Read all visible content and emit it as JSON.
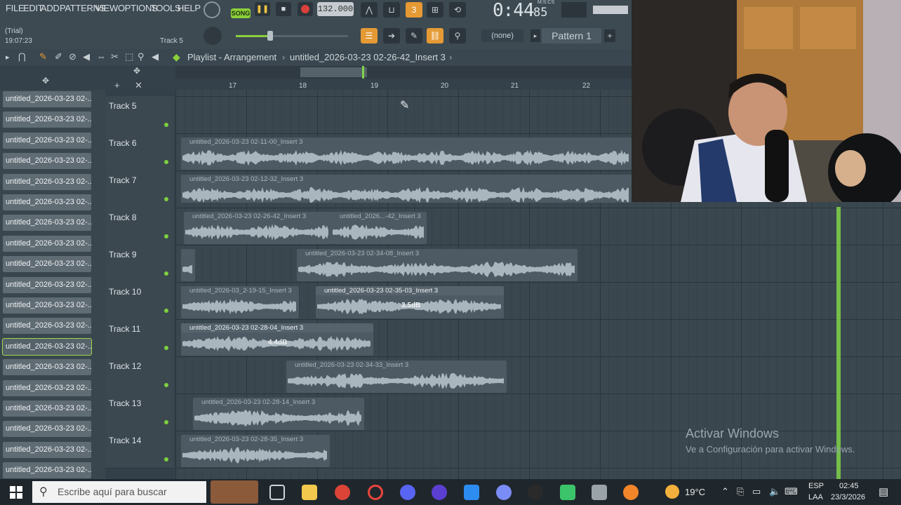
{
  "menu": [
    "FILE",
    "EDIT",
    "ADD",
    "PATTERNS",
    "VIEW",
    "OPTIONS",
    "TOOLS",
    "HELP"
  ],
  "trial": {
    "label": "(Trial)",
    "time": "19:07:23",
    "track": "Track 5"
  },
  "transport": {
    "song_label": "SONG",
    "bpm": "132.000",
    "time_main": "0:44",
    "time_sub": "85",
    "time_unit": "M:S:CS"
  },
  "selectors": {
    "none_label": "(none)",
    "pattern_label": "Pattern 1"
  },
  "playlist": {
    "title": "Playlist - Arrangement",
    "breadcrumb": "untitled_2026-03-23 02-26-42_Insert 3",
    "arrow": "›"
  },
  "ruler": [
    "17",
    "18",
    "19",
    "20",
    "21",
    "22"
  ],
  "browser_items": [
    "untitled_2026-03-23 02-...",
    "untitled_2026-03-23 02-...",
    "untitled_2026-03-23 02-...",
    "untitled_2026-03-23 02-...",
    "untitled_2026-03-23 02-...",
    "untitled_2026-03-23 02-...",
    "untitled_2026-03-23 02-...",
    "untitled_2026-03-23 02-...",
    "untitled_2026-03-23 02-...",
    "untitled_2026-03-23 02-...",
    "untitled_2026-03-23 02-...",
    "untitled_2026-03-23 02-...",
    "untitled_2026-03-23 02-...",
    "untitled_2026-03-23 02-...",
    "untitled_2026-03-23 02-...",
    "untitled_2026-03-23 02-...",
    "untitled_2026-03-23 02-...",
    "untitled_2026-03-23 02-...",
    "untitled_2026-03-23 02-..."
  ],
  "tracks": [
    "Track 5",
    "Track 6",
    "Track 7",
    "Track 8",
    "Track 9",
    "Track 10",
    "Track 11",
    "Track 12",
    "Track 13",
    "Track 14"
  ],
  "clips": {
    "c6": "untitled_2026-03-23 02-11-00_Insert 3",
    "c7": "untitled_2026-03-23 02-12-32_Insert 3",
    "c8a": "untitled_2026-03-23 02-26-42_Insert 3",
    "c8b": "untitled_2026...-42_Insert 3",
    "c9": "untitled_2026-03-23 02-34-08_Insert 3",
    "c10a": "untitled_2026-03_2-19-15_Insert 3",
    "c10b": "untitled_2026-03-23 02-35-03_Insert 3",
    "c11": "untitled_2026-03-23 02-28-04_Insert 3",
    "c12": "untitled_2026-03-23 02-34-33_Insert 3",
    "c13": "untitled_2026-03-23 02-28-14_Insert 3",
    "c14": "untitled_2026-03-23 02-28-35_Insert 3"
  },
  "gain": {
    "c10b": "3.5dB",
    "c11": "4.4dB"
  },
  "watermark": {
    "line1": "Activar Windows",
    "line2": "Ve a Configuración para activar Windows."
  },
  "taskbar": {
    "search_placeholder": "Escribe aquí para buscar",
    "weather": "19°C",
    "lang1": "ESP",
    "lang2": "LAA",
    "time": "02:45",
    "date": "23/3/2026"
  },
  "colors": {
    "accent_green": "#7fd34a",
    "record_red": "#d9413a",
    "orange": "#e59a34"
  }
}
